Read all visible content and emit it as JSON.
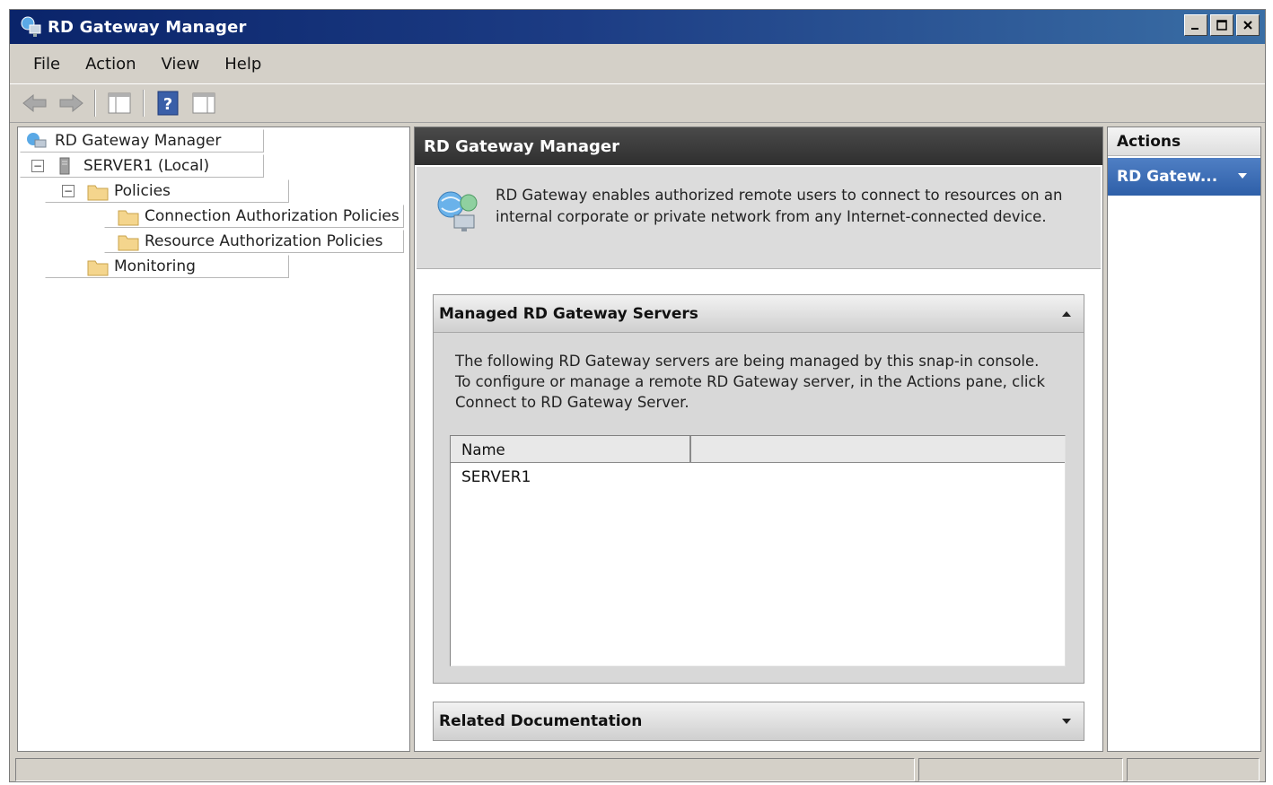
{
  "window": {
    "title": "RD Gateway Manager",
    "controls": [
      "minimize",
      "maximize",
      "close"
    ]
  },
  "menubar": {
    "items": [
      "File",
      "Action",
      "View",
      "Help"
    ]
  },
  "toolbar": {
    "buttons": [
      "back-arrow-icon",
      "forward-arrow-icon",
      "show-hide-console-tree-icon",
      "help-icon",
      "show-hide-action-pane-icon"
    ]
  },
  "tree": {
    "root": "RD Gateway Manager",
    "server": "SERVER1 (Local)",
    "policies": "Policies",
    "cap": "Connection Authorization Policies",
    "rap": "Resource Authorization Policies",
    "monitoring": "Monitoring"
  },
  "main": {
    "header": "RD Gateway Manager",
    "info": "RD Gateway enables authorized remote users to connect to resources on an internal corporate or private network from any Internet-connected device.",
    "managed_section": {
      "title": "Managed RD Gateway Servers",
      "description": "The following RD Gateway servers are being managed by this snap-in console. To configure or manage a remote RD Gateway server, in the Actions pane, click Connect to RD Gateway Server.",
      "columns": [
        "Name",
        ""
      ],
      "rows": [
        "SERVER1"
      ]
    },
    "related_section": {
      "title": "Related Documentation"
    }
  },
  "actions": {
    "header": "Actions",
    "item": "RD Gatew..."
  },
  "colors": {
    "titlebar": "#0a246a",
    "chrome": "#d4d0c8",
    "center_header": "#2f2f2f",
    "actions_selected": "#2e5fa8"
  }
}
